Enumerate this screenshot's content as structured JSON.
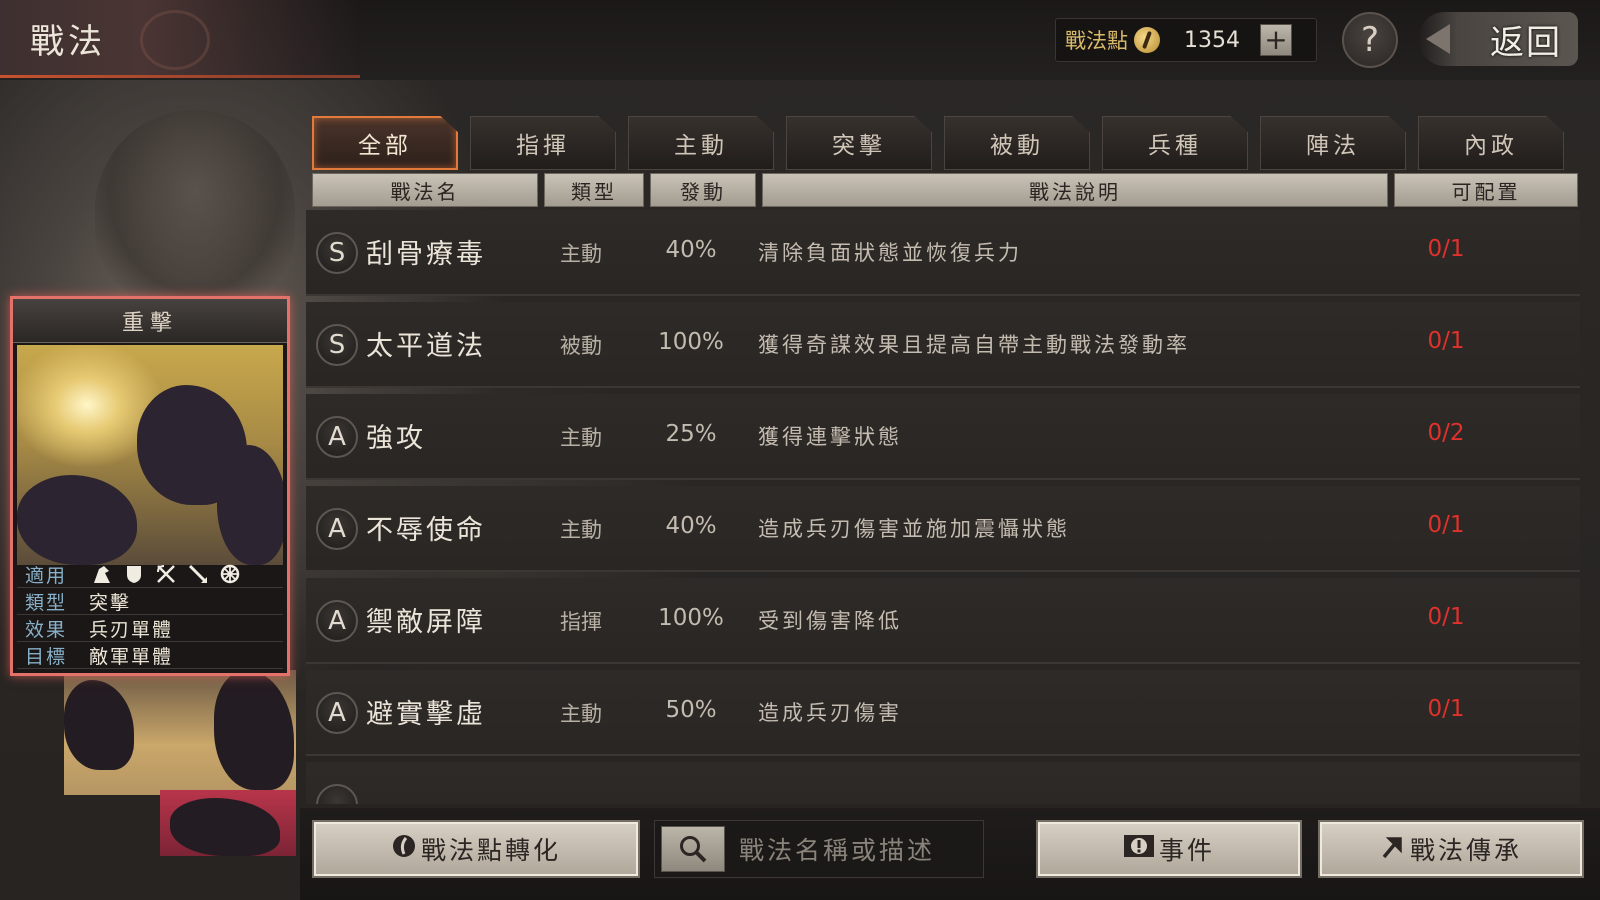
{
  "header": {
    "title": "戰法",
    "points_label": "戰法點",
    "points_value": "1354",
    "plus_label": "+",
    "help_label": "?",
    "back_label": "返回"
  },
  "tabs": [
    {
      "label": "全部",
      "active": true
    },
    {
      "label": "指揮",
      "active": false
    },
    {
      "label": "主動",
      "active": false
    },
    {
      "label": "突擊",
      "active": false
    },
    {
      "label": "被動",
      "active": false
    },
    {
      "label": "兵種",
      "active": false
    },
    {
      "label": "陣法",
      "active": false
    },
    {
      "label": "內政",
      "active": false
    }
  ],
  "columns": {
    "name": "戰法名",
    "type": "類型",
    "rate": "發動",
    "desc": "戰法說明",
    "slots": "可配置"
  },
  "skills": [
    {
      "grade": "S",
      "name": "刮骨療毒",
      "type": "主動",
      "rate": "40%",
      "desc": "清除負面狀態並恢復兵力",
      "slots": "0/1"
    },
    {
      "grade": "S",
      "name": "太平道法",
      "type": "被動",
      "rate": "100%",
      "desc": "獲得奇謀效果且提高自帶主動戰法發動率",
      "slots": "0/1"
    },
    {
      "grade": "A",
      "name": "強攻",
      "type": "主動",
      "rate": "25%",
      "desc": "獲得連擊狀態",
      "slots": "0/2"
    },
    {
      "grade": "A",
      "name": "不辱使命",
      "type": "主動",
      "rate": "40%",
      "desc": "造成兵刃傷害並施加震懾狀態",
      "slots": "0/1"
    },
    {
      "grade": "A",
      "name": "禦敵屏障",
      "type": "指揮",
      "rate": "100%",
      "desc": "受到傷害降低",
      "slots": "0/1"
    },
    {
      "grade": "A",
      "name": "避實擊虛",
      "type": "主動",
      "rate": "50%",
      "desc": "造成兵刃傷害",
      "slots": "0/1"
    }
  ],
  "card": {
    "title": "重擊",
    "applicable_label": "適用",
    "troop_icons": [
      "cavalry-icon",
      "shield-icon",
      "bow-icon",
      "spear-icon",
      "wheel-icon"
    ],
    "type_label": "類型",
    "type_value": "突擊",
    "effect_label": "效果",
    "effect_value": "兵刃單體",
    "target_label": "目標",
    "target_value": "敵軍單體"
  },
  "bottom": {
    "convert_label": "戰法點轉化",
    "search_placeholder": "戰法名稱或描述",
    "event_label": "事件",
    "inherit_label": "戰法傳承"
  },
  "colors": {
    "accent": "#e17a3a",
    "slots_red": "#e0312c",
    "card_border": "#e5726a"
  }
}
